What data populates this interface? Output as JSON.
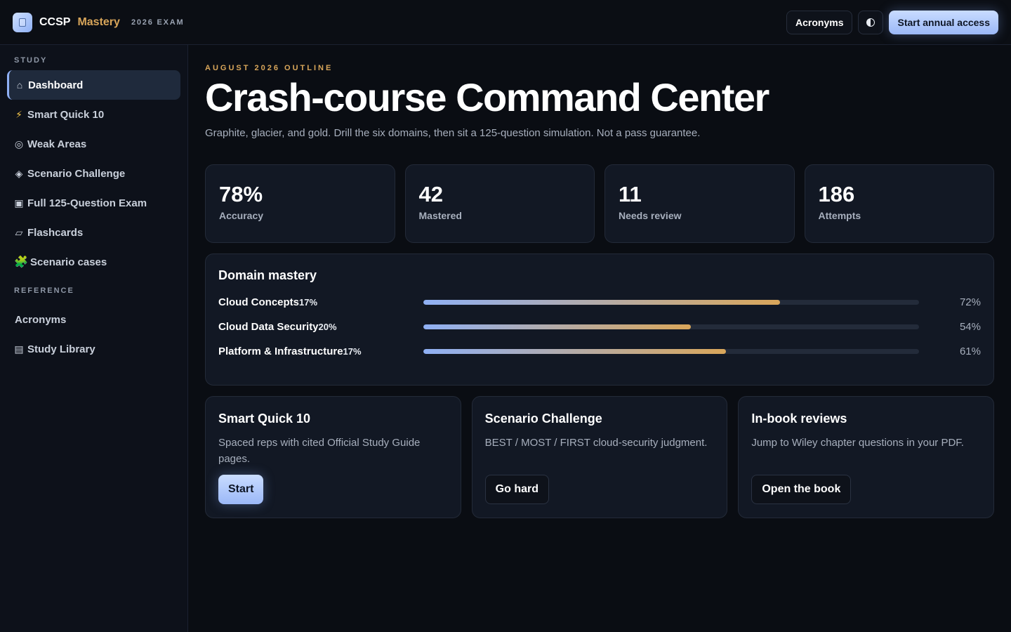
{
  "header": {
    "brand_name": "CCSP",
    "brand_accent": "Mastery",
    "brand_tag": "2026 EXAM",
    "acronyms_label": "Acronyms",
    "theme_icon": "contrast-icon",
    "cta_label": "Start annual access"
  },
  "sidebar": {
    "study_label": "STUDY",
    "reference_label": "REFERENCE",
    "study_items": [
      {
        "icon": "⌂",
        "label": "Dashboard",
        "active": true
      },
      {
        "icon": "⚡",
        "label": "Smart Quick 10"
      },
      {
        "icon": "◎",
        "label": "Weak Areas"
      },
      {
        "icon": "◈",
        "label": "Scenario Challenge"
      },
      {
        "icon": "▣",
        "label": "Full 125-Question Exam"
      },
      {
        "icon": "▱",
        "label": "Flashcards"
      },
      {
        "icon": "🧩",
        "label": "Scenario cases"
      }
    ],
    "reference_items": [
      {
        "icon": "",
        "label": "Acronyms"
      },
      {
        "icon": "▤",
        "label": "Study Library"
      }
    ]
  },
  "main": {
    "eyebrow": "AUGUST 2026 OUTLINE",
    "title": "Crash-course Command Center",
    "subtitle": "Graphite, glacier, and gold. Drill the six domains, then sit a 125-question simulation. Not a pass guarantee.",
    "stats": [
      {
        "value": "78%",
        "label": "Accuracy"
      },
      {
        "value": "42",
        "label": "Mastered"
      },
      {
        "value": "11",
        "label": "Needs review"
      },
      {
        "value": "186",
        "label": "Attempts"
      }
    ],
    "mastery": {
      "title": "Domain mastery",
      "domains": [
        {
          "name": "Cloud Concepts",
          "weight": "17%",
          "percent": 72,
          "percent_label": "72%"
        },
        {
          "name": "Cloud Data Security",
          "weight": "20%",
          "percent": 54,
          "percent_label": "54%"
        },
        {
          "name": "Platform & Infrastructure",
          "weight": "17%",
          "percent": 61,
          "percent_label": "61%"
        }
      ]
    },
    "actions": [
      {
        "title": "Smart Quick 10",
        "desc": "Spaced reps with cited Official Study Guide pages.",
        "button": "Start",
        "primary": true
      },
      {
        "title": "Scenario Challenge",
        "desc": "BEST / MOST / FIRST cloud-security judgment.",
        "button": "Go hard",
        "primary": false
      },
      {
        "title": "In-book reviews",
        "desc": "Jump to Wiley chapter questions in your PDF.",
        "button": "Open the book",
        "primary": false
      }
    ]
  },
  "colors": {
    "accent_blue": "#8fb0f5",
    "accent_gold": "#d9a65a",
    "background": "#0a0d13",
    "card": "#121824"
  }
}
